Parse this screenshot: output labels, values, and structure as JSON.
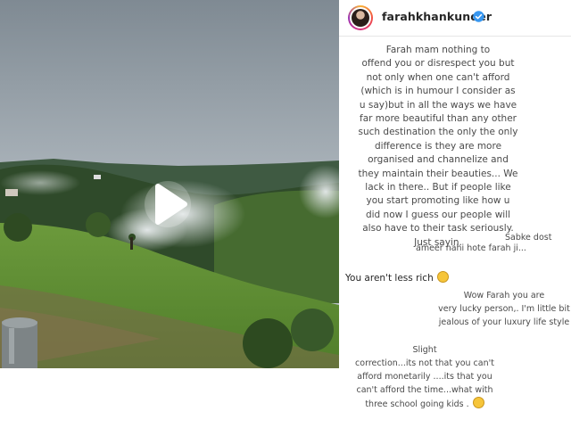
{
  "post": {
    "username": "farahkhankunder",
    "verified": true
  },
  "video": {
    "state": "paused"
  },
  "comments": [
    {
      "text": "Farah mam nothing to\noffend you or disrespect you but\nnot only when one can't afford\n(which is in humour I consider as\nu say)but in all the ways we have\nfar more beautiful than any other\nsuch destination the only the only\ndifference is they are more\norganised and channelize and\nthey maintain their beauties... We\nlack in there.. But if people like\nyou start promoting like how u\ndid now I guess our people will\nalso have to their task seriously.\nJust sayin."
    },
    {
      "text": "Sabke dost"
    },
    {
      "text": "ameer nahi hote farah ji..."
    },
    {
      "text": "You aren't less rich",
      "emoji": "grinning-sweat-emoji"
    },
    {
      "text": "Wow Farah you are\nvery lucky person,. I'm little bit\njealous of your luxury life style"
    },
    {
      "text": "Slight\ncorrection...its not that you can't\nafford monetarily ....its that you\ncan't afford the time...what with\nthree school going kids .",
      "emoji": "smiling-emoji"
    }
  ],
  "colors": {
    "verified_badge": "#3897f0",
    "text": "#262626",
    "comment_text": "#4a4a4a"
  }
}
